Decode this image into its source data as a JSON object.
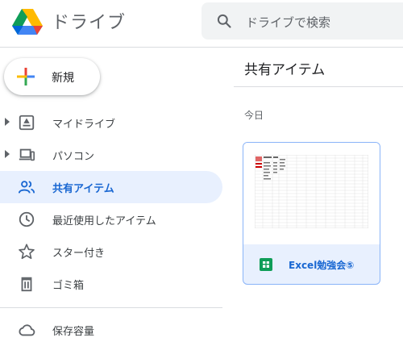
{
  "header": {
    "app_title": "ドライブ",
    "search_placeholder": "ドライブで検索"
  },
  "new_button": {
    "label": "新規"
  },
  "sidebar": {
    "items": [
      {
        "label": "マイドライブ",
        "icon": "my-drive-icon",
        "expandable": true,
        "active": false
      },
      {
        "label": "パソコン",
        "icon": "computers-icon",
        "expandable": true,
        "active": false
      },
      {
        "label": "共有アイテム",
        "icon": "people-icon",
        "expandable": false,
        "active": true
      },
      {
        "label": "最近使用したアイテム",
        "icon": "clock-icon",
        "expandable": false,
        "active": false
      },
      {
        "label": "スター付き",
        "icon": "star-icon",
        "expandable": false,
        "active": false
      },
      {
        "label": "ゴミ箱",
        "icon": "trash-icon",
        "expandable": false,
        "active": false
      },
      {
        "label": "保存容量",
        "icon": "cloud-icon",
        "expandable": false,
        "active": false
      }
    ]
  },
  "main": {
    "title": "共有アイテム",
    "section": "今日",
    "files": [
      {
        "name": "Excel勉強会⑤",
        "type_icon": "google-sheets-icon"
      }
    ]
  },
  "colors": {
    "accent": "#1967d2",
    "active_bg": "#e8f0fe",
    "sheets_green": "#0f9d58"
  }
}
